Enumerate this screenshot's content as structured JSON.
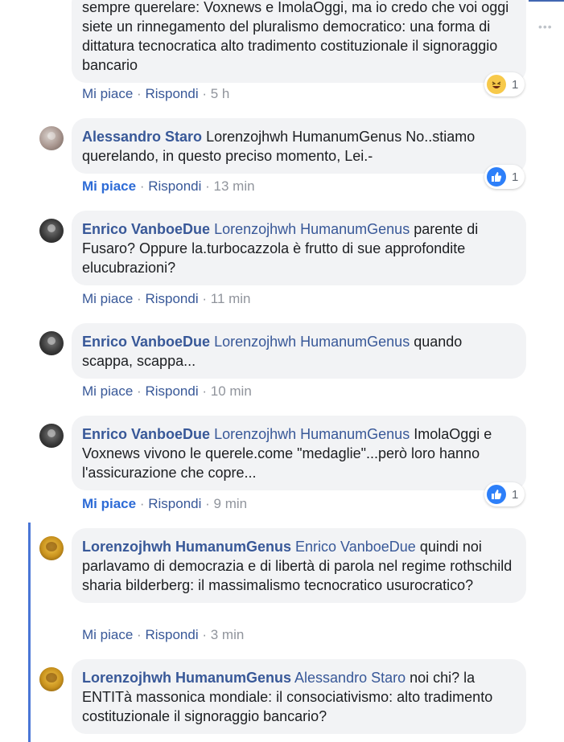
{
  "comments": [
    {
      "author": "",
      "text": "sempre querelare: Voxnews e ImolaOggi, ma io credo che voi oggi siete un rinnegamento del pluralismo democratico: una forma di dittatura tecnocratica alto tradimento costituzionale il signoraggio bancario",
      "like_label": "Mi piace",
      "reply_label": "Rispondi",
      "time": "5 h",
      "reaction": {
        "type": "haha",
        "count": "1"
      }
    },
    {
      "author": "Alessandro Staro",
      "mention": "",
      "text": "Lorenzojhwh HumanumGenus No..stiamo querelando, in questo preciso momento, Lei.-",
      "like_label": "Mi piace",
      "reply_label": "Rispondi",
      "time": "13 min",
      "liked": true,
      "reaction": {
        "type": "like",
        "count": "1"
      }
    },
    {
      "author": "Enrico VanboeDue",
      "mention": "Lorenzojhwh HumanumGenus",
      "text": "parente di Fusaro? Oppure la.turbocazzola è frutto di sue approfondite elucubrazioni?",
      "like_label": "Mi piace",
      "reply_label": "Rispondi",
      "time": "11 min"
    },
    {
      "author": "Enrico VanboeDue",
      "mention": "Lorenzojhwh HumanumGenus",
      "text": "quando scappa, scappa...",
      "like_label": "Mi piace",
      "reply_label": "Rispondi",
      "time": "10 min"
    },
    {
      "author": "Enrico VanboeDue",
      "mention": "Lorenzojhwh HumanumGenus",
      "text": "ImolaOggi e Voxnews vivono le querele.come \"medaglie\"...però loro hanno l'assicurazione che copre...",
      "like_label": "Mi piace",
      "reply_label": "Rispondi",
      "time": "9 min",
      "liked": true,
      "reaction": {
        "type": "like",
        "count": "1"
      }
    },
    {
      "author": "Lorenzojhwh HumanumGenus",
      "mention": "Enrico VanboeDue",
      "text": "quindi noi parlavamo di democrazia e di libertà di parola nel regime rothschild sharia bilderberg: il massimalismo tecnocratico usurocratico?",
      "like_label": "Mi piace",
      "reply_label": "Rispondi",
      "time": "3 min"
    },
    {
      "author": "Lorenzojhwh HumanumGenus",
      "mention": "Alessandro Staro",
      "text": "noi chi? la ENTITà massonica mondiale: il consociativismo: alto tradimento costituzionale il signoraggio bancario?"
    }
  ],
  "separator": "·",
  "more_icon": "more-horizontal-icon",
  "colors": {
    "link": "#385898",
    "bubble": "#f2f3f5",
    "liked": "#2d6bd6",
    "thread": "#4a76d6"
  }
}
